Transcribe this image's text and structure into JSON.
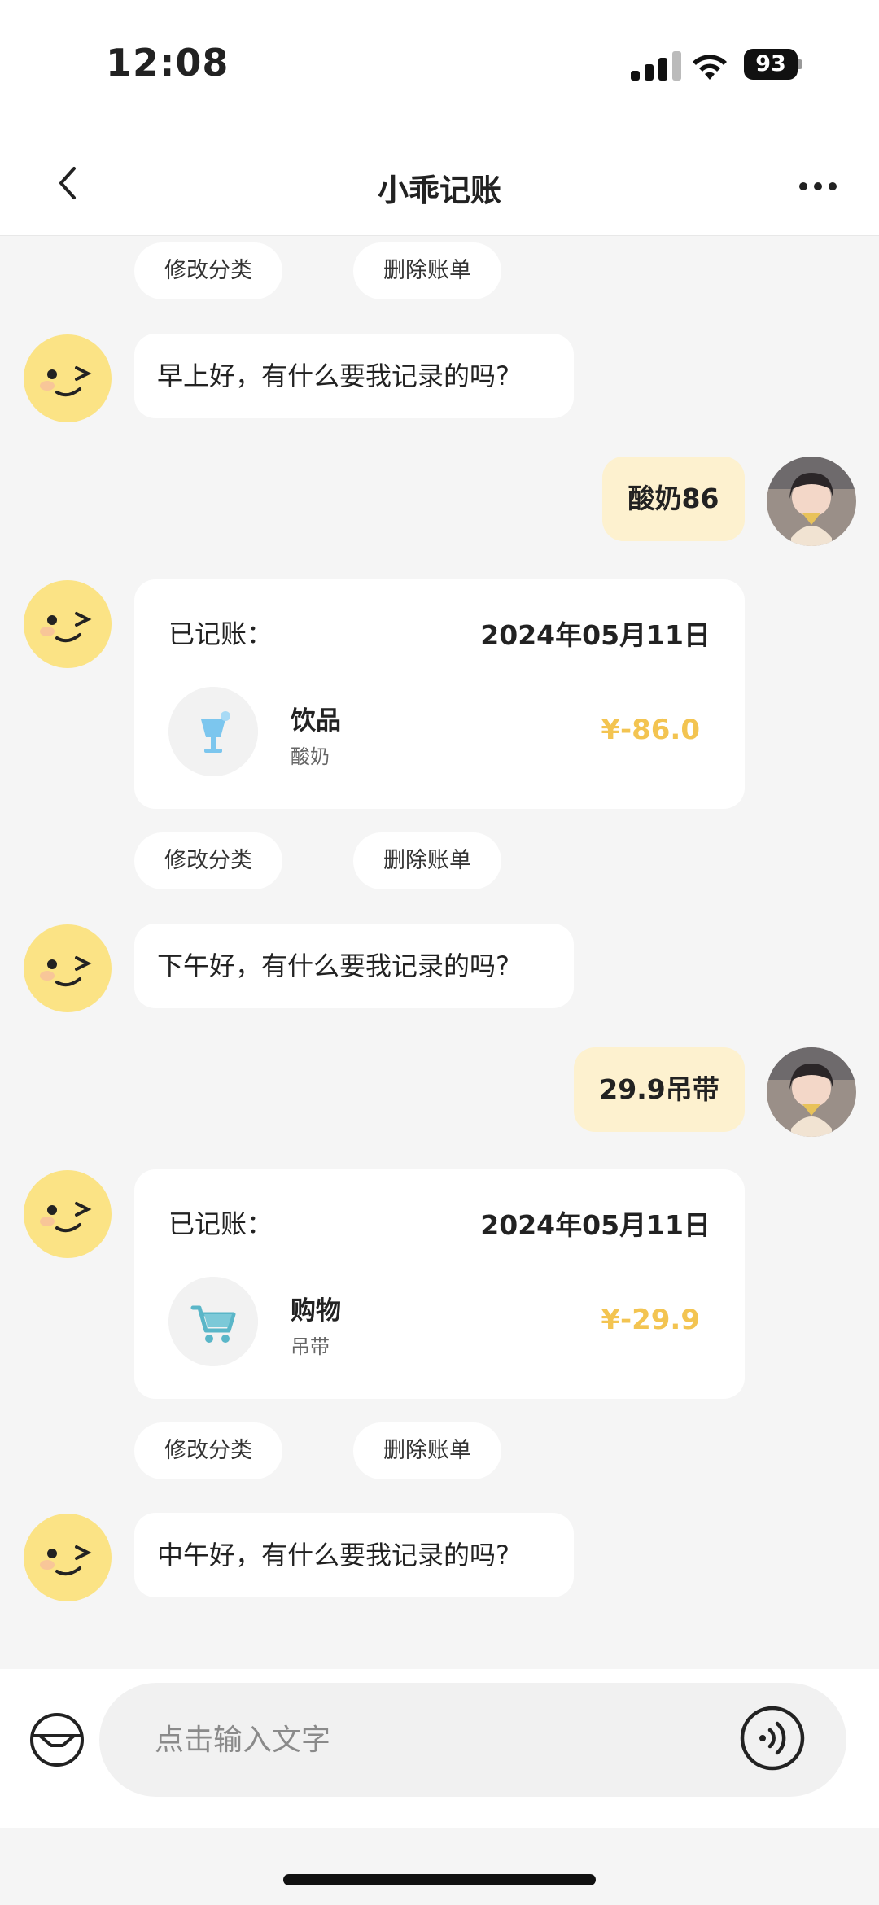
{
  "status_bar": {
    "time": "12:08",
    "battery": "93"
  },
  "nav": {
    "title": "小乖记账"
  },
  "actions": {
    "edit_category": "修改分类",
    "delete_bill": "删除账单"
  },
  "messages": [
    {
      "type": "bot",
      "text": "早上好，有什么要我记录的吗?"
    },
    {
      "type": "user",
      "text": "酸奶86"
    },
    {
      "type": "record",
      "label": "已记账：",
      "date": "2024年05月11日",
      "category": "饮品",
      "note": "酸奶",
      "amount": "¥-86.0",
      "icon": "drink-icon"
    },
    {
      "type": "bot",
      "text": "下午好，有什么要我记录的吗?"
    },
    {
      "type": "user",
      "text": "29.9吊带"
    },
    {
      "type": "record",
      "label": "已记账：",
      "date": "2024年05月11日",
      "category": "购物",
      "note": "吊带",
      "amount": "¥-29.9",
      "icon": "shopping-cart-icon"
    },
    {
      "type": "bot",
      "text": "中午好，有什么要我记录的吗?"
    }
  ],
  "input": {
    "placeholder": "点击输入文字"
  },
  "colors": {
    "accent": "#f3c451",
    "user_bubble": "#fdf1cf",
    "background": "#f5f5f5"
  }
}
